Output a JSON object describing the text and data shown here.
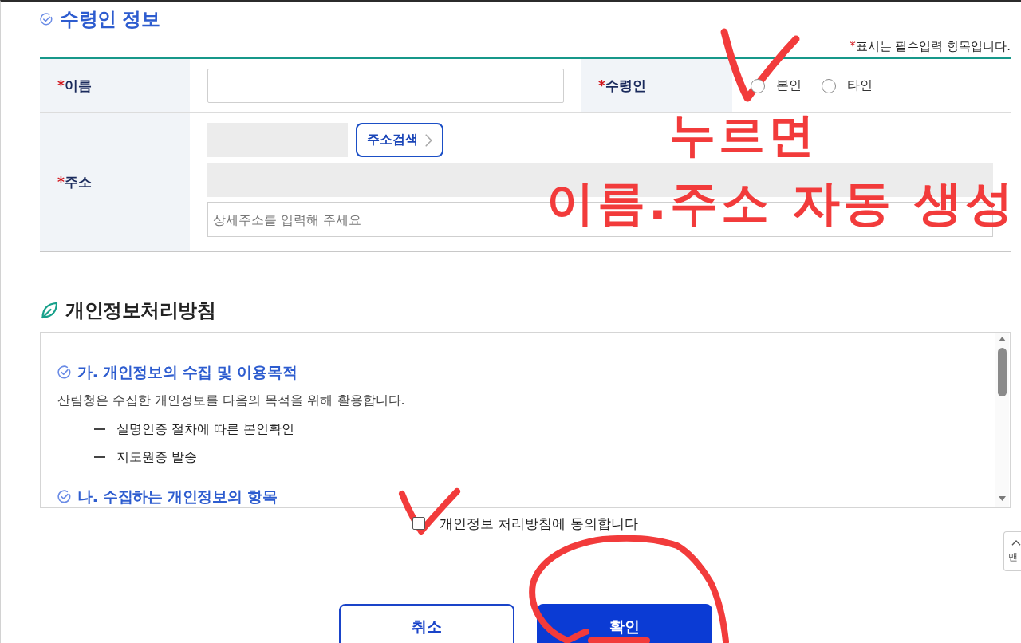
{
  "recipient": {
    "title": "수령인 정보",
    "note": {
      "mark": "*",
      "text": "표시는 필수입력 항목입니다."
    },
    "name": {
      "mark": "*",
      "label": "이름"
    },
    "receiver": {
      "mark": "*",
      "label": "수령인",
      "options": [
        {
          "label": "본인",
          "selected": false
        },
        {
          "label": "타인",
          "selected": false
        }
      ]
    },
    "address": {
      "mark": "*",
      "label": "주소",
      "search_button": "주소검색",
      "detail_placeholder": "상세주소를 입력해 주세요"
    }
  },
  "privacy": {
    "title": "개인정보처리방침",
    "sections": [
      {
        "heading": "가. 개인정보의 수집 및 이용목적",
        "text": "산림청은 수집한 개인정보를 다음의 목적을 위해 활용합니다.",
        "items": [
          "실명인증 절차에 따른 본인확인",
          "지도원증 발송"
        ]
      },
      {
        "heading": "나. 수집하는 개인정보의 항목"
      }
    ],
    "agree": {
      "label": "개인정보 처리방침에 동의합니다",
      "checked": false
    }
  },
  "buttons": [
    {
      "label": "취소",
      "kind": "secondary"
    },
    {
      "label": "확인",
      "kind": "primary"
    }
  ],
  "top_button": {
    "label": "맨"
  },
  "annotations": {
    "lines": [
      "누르면",
      "이름.주소 자동 생성"
    ]
  }
}
